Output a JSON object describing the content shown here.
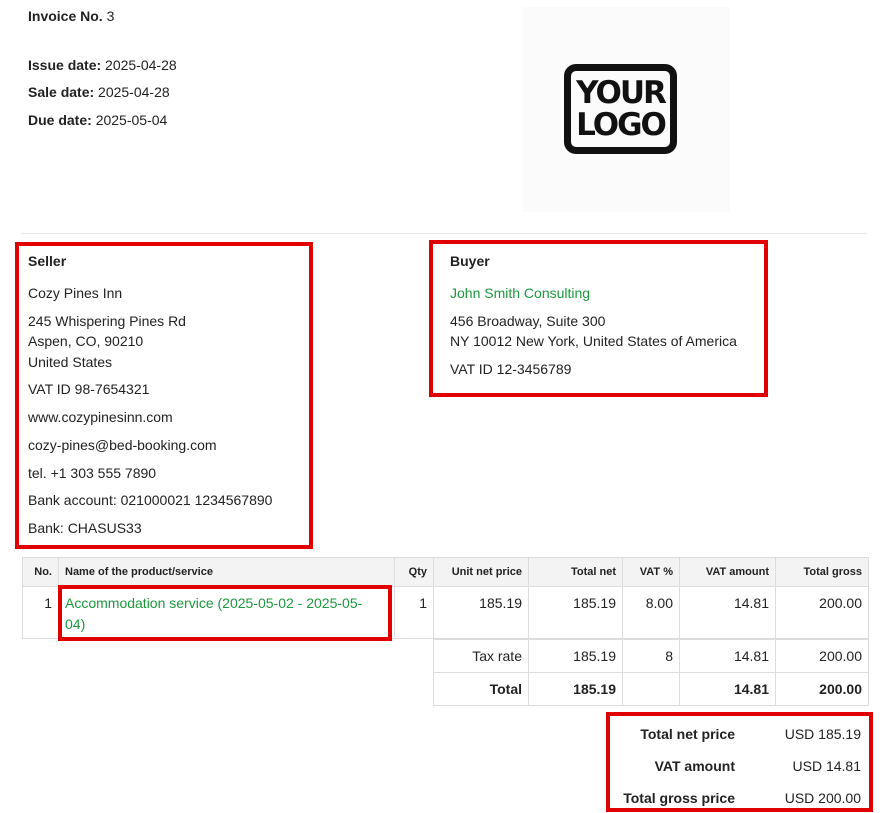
{
  "header": {
    "invoice_label": "Invoice No.",
    "invoice_no": "3",
    "issue_label": "Issue date:",
    "issue_date": "2025-04-28",
    "sale_label": "Sale date:",
    "sale_date": "2025-04-28",
    "due_label": "Due date:",
    "due_date": "2025-05-04",
    "logo_line1": "YOUR",
    "logo_line2": "LOGO"
  },
  "seller": {
    "title": "Seller",
    "name": "Cozy Pines Inn",
    "address1": "245 Whispering Pines Rd",
    "address2": "Aspen, CO, 90210",
    "country": "United States",
    "vat": "VAT ID 98-7654321",
    "website": "www.cozypinesinn.com",
    "email": "cozy-pines@bed-booking.com",
    "tel": "tel. +1 303 555 7890",
    "bank_account": "Bank account: 021000021 1234567890",
    "bank": "Bank: CHASUS33"
  },
  "buyer": {
    "title": "Buyer",
    "name": "John Smith Consulting",
    "address1": "456 Broadway, Suite 300",
    "address2": "NY 10012 New York, United States of America",
    "vat": "VAT ID 12-3456789"
  },
  "table": {
    "headers": [
      "No.",
      "Name of the product/service",
      "Qty",
      "Unit net price",
      "Total net",
      "VAT %",
      "VAT amount",
      "Total gross"
    ],
    "rows": [
      {
        "no": "1",
        "name_line1": "Accommodation service (2025-05-02 - 2025-05-",
        "name_line2": "04)",
        "qty": "1",
        "unit_net": "185.19",
        "total_net": "185.19",
        "vat_pct": "8.00",
        "vat_amount": "14.81",
        "total_gross": "200.00"
      }
    ],
    "tax_rate_row": {
      "label": "Tax rate",
      "total_net": "185.19",
      "vat_pct": "8",
      "vat_amount": "14.81",
      "total_gross": "200.00"
    },
    "total_row": {
      "label": "Total",
      "total_net": "185.19",
      "vat_amount": "14.81",
      "total_gross": "200.00"
    }
  },
  "totals": {
    "net_label": "Total net price",
    "net_value": "USD 185.19",
    "vat_label": "VAT amount",
    "vat_value": "USD 14.81",
    "gross_label": "Total gross price",
    "gross_value": "USD 200.00"
  },
  "colors": {
    "highlight_box": "#e00000",
    "link_green": "#1a9a3c",
    "header_bg": "#f3f3f3"
  }
}
